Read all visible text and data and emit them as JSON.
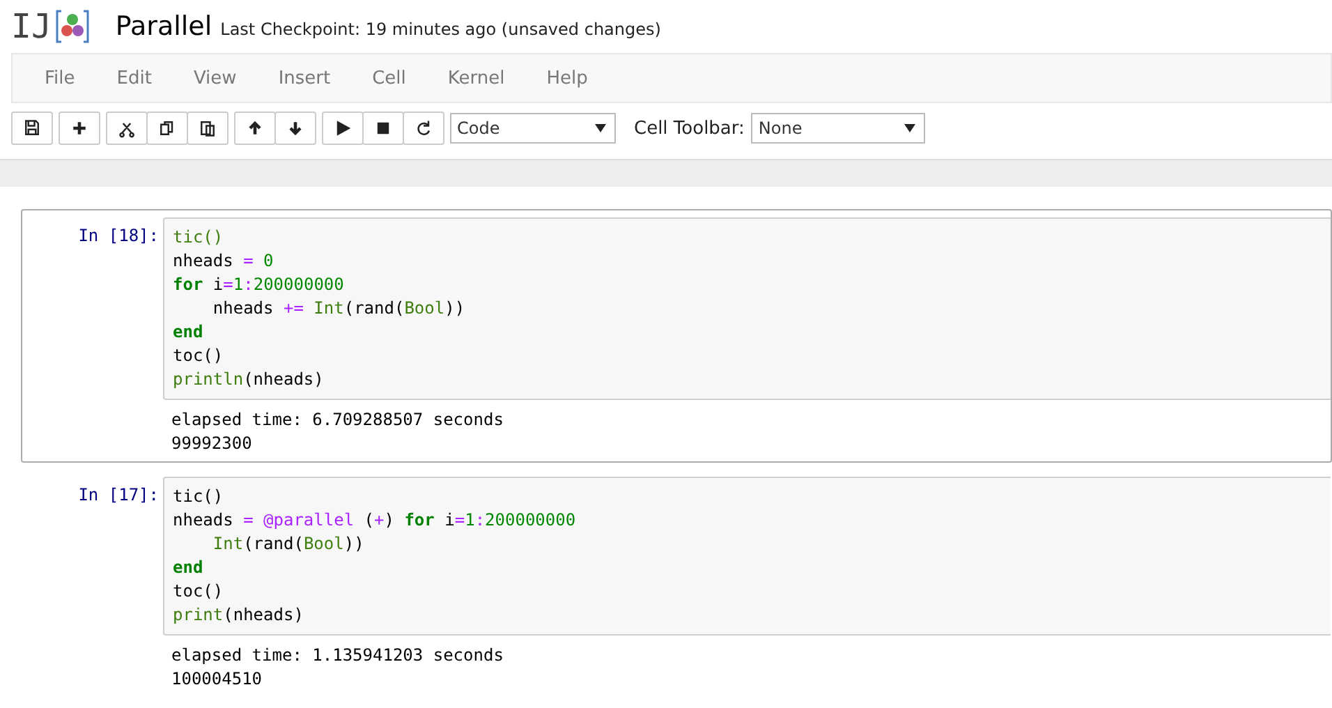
{
  "header": {
    "logo": "IJ",
    "title": "Parallel",
    "checkpoint": "Last Checkpoint: 19 minutes ago (unsaved changes)"
  },
  "menu": [
    "File",
    "Edit",
    "View",
    "Insert",
    "Cell",
    "Kernel",
    "Help"
  ],
  "toolbar": {
    "groups": [
      [
        {
          "kind": "save"
        }
      ],
      [
        {
          "kind": "add"
        }
      ],
      [
        {
          "kind": "cut"
        },
        {
          "kind": "copy"
        },
        {
          "kind": "paste"
        }
      ],
      [
        {
          "kind": "up"
        },
        {
          "kind": "down"
        }
      ],
      [
        {
          "kind": "run"
        },
        {
          "kind": "stop"
        },
        {
          "kind": "restart"
        }
      ]
    ],
    "cell_type": "Code",
    "cell_toolbar_label": "Cell Toolbar:",
    "cell_toolbar_value": "None"
  },
  "cells": [
    {
      "prompt": "In [18]:",
      "selected": true,
      "lines": [
        [
          {
            "text": "tic()",
            "kind": "builtin"
          }
        ],
        [
          {
            "text": "nheads ",
            "kind": "plain"
          },
          {
            "text": "=",
            "kind": "operator"
          },
          {
            "text": " 0",
            "kind": "number"
          }
        ],
        [
          {
            "text": "for",
            "kind": "keyword"
          },
          {
            "text": " i",
            "kind": "plain"
          },
          {
            "text": "=",
            "kind": "operator"
          },
          {
            "text": "1",
            "kind": "number"
          },
          {
            "text": ":",
            "kind": "operator"
          },
          {
            "text": "200000000",
            "kind": "number"
          }
        ],
        [
          {
            "text": "    nheads ",
            "kind": "plain"
          },
          {
            "text": "+=",
            "kind": "operator"
          },
          {
            "text": " Int",
            "kind": "builtin"
          },
          {
            "text": "(rand(",
            "kind": "plain"
          },
          {
            "text": "Bool",
            "kind": "builtin"
          },
          {
            "text": "))",
            "kind": "plain"
          }
        ],
        [
          {
            "text": "end",
            "kind": "keyword"
          }
        ],
        [
          {
            "text": "toc()",
            "kind": "plain"
          }
        ],
        [
          {
            "text": "println",
            "kind": "builtin"
          },
          {
            "text": "(nheads)",
            "kind": "plain"
          }
        ]
      ],
      "output": [
        "elapsed time: 6.709288507 seconds",
        "99992300"
      ]
    },
    {
      "prompt": "In [17]:",
      "selected": false,
      "lines": [
        [
          {
            "text": "tic()",
            "kind": "plain"
          }
        ],
        [
          {
            "text": "nheads ",
            "kind": "plain"
          },
          {
            "text": "=",
            "kind": "operator"
          },
          {
            "text": " @parallel",
            "kind": "macro"
          },
          {
            "text": " (",
            "kind": "plain"
          },
          {
            "text": "+",
            "kind": "operator"
          },
          {
            "text": ") ",
            "kind": "plain"
          },
          {
            "text": "for",
            "kind": "keyword"
          },
          {
            "text": " i",
            "kind": "plain"
          },
          {
            "text": "=",
            "kind": "operator"
          },
          {
            "text": "1",
            "kind": "number"
          },
          {
            "text": ":",
            "kind": "operator"
          },
          {
            "text": "200000000",
            "kind": "number"
          }
        ],
        [
          {
            "text": "    Int",
            "kind": "builtin"
          },
          {
            "text": "(rand(",
            "kind": "plain"
          },
          {
            "text": "Bool",
            "kind": "builtin"
          },
          {
            "text": "))",
            "kind": "plain"
          }
        ],
        [
          {
            "text": "end",
            "kind": "keyword"
          }
        ],
        [
          {
            "text": "toc()",
            "kind": "plain"
          }
        ],
        [
          {
            "text": "print",
            "kind": "builtin"
          },
          {
            "text": "(nheads)",
            "kind": "plain"
          }
        ]
      ],
      "output": [
        "elapsed time: 1.135941203 seconds",
        "100004510"
      ]
    }
  ]
}
